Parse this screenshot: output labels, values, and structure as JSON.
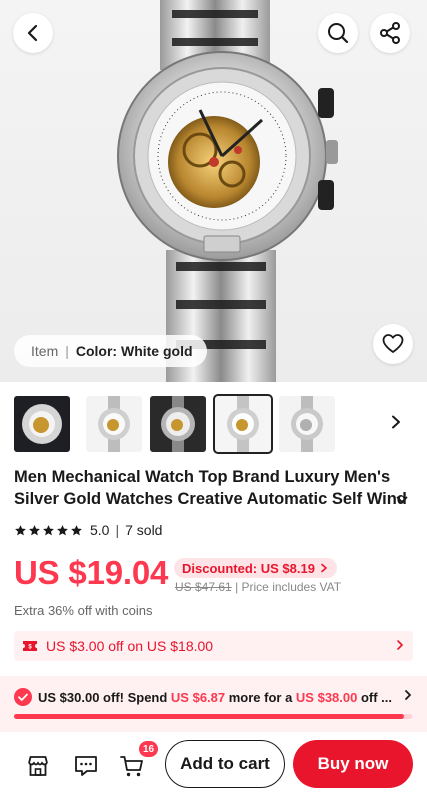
{
  "header": {
    "back_icon": "chevron-left-icon",
    "search_icon": "search-icon",
    "share_icon": "share-icon"
  },
  "hero": {
    "image": "skeleton-watch-product-photo",
    "sku": {
      "prefix": "Item",
      "label": "Color: White gold"
    },
    "favorite_icon": "heart-outline-icon"
  },
  "thumbnails": {
    "count": 5,
    "selected_index": 3
  },
  "product": {
    "title": "Men Mechanical Watch Top Brand Luxury Men's Silver Gold Watches Creative Automatic Self Wind",
    "rating": "5.0",
    "sold": "7 sold",
    "price": "US $19.04",
    "discount_badge": "Discounted: US $8.19",
    "original_price": "US $47.61",
    "price_note": "| Price includes VAT",
    "coins_text": "Extra 36% off with coins"
  },
  "coupon": {
    "text": "US $3.00 off on US $18.00"
  },
  "promo": {
    "part1": "US $30.00 off! Spend ",
    "amount": "US $6.87",
    "part2": " more for a ",
    "target": "US $38.00",
    "part3": " off ...",
    "progress": 0.98
  },
  "bottom_bar": {
    "store_icon": "store-icon",
    "chat_icon": "chat-icon",
    "cart_icon": "cart-icon",
    "cart_count": "16",
    "add_to_cart": "Add to cart",
    "buy_now": "Buy now"
  },
  "colors": {
    "accent_red": "#fd384f",
    "button_red": "#e8152c",
    "pink_bg": "#fff1f2"
  }
}
